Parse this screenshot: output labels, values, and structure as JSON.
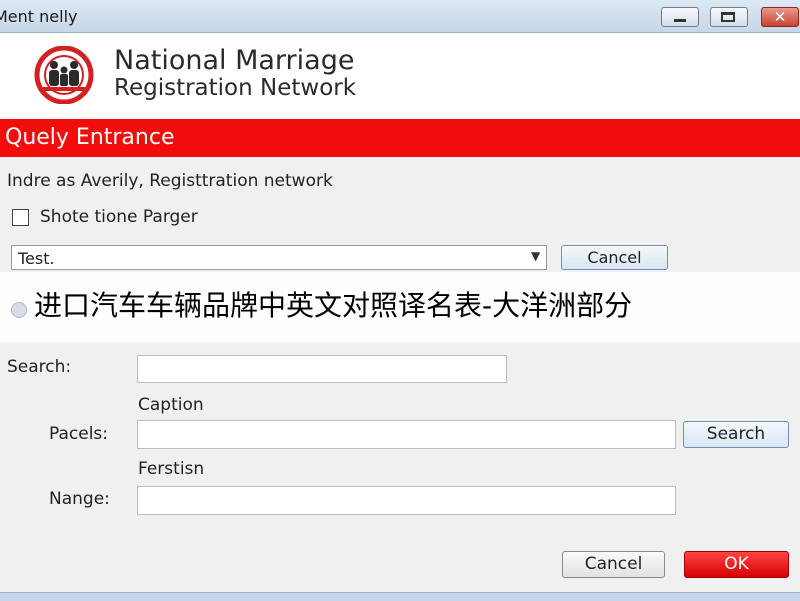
{
  "window": {
    "title": "Ment nelly",
    "controls": {
      "minimize_icon": "minimize-icon",
      "maximize_icon": "maximize-icon",
      "close_icon": "close-icon",
      "close_glyph": "✕"
    }
  },
  "header": {
    "org_line1": "National Marriage",
    "org_line2": "Registration Network",
    "logo_icon": "family-emblem-icon",
    "colors": {
      "accent": "#f20d0d",
      "logo_red": "#d42020"
    }
  },
  "banner": {
    "title": "Quely Entrance"
  },
  "form": {
    "description": "Indre as Averily, Registtration network",
    "checkbox_label": "Shote tione Parger",
    "checkbox_checked": false,
    "combo_value": "Test.",
    "cancel_top_label": "Cancel"
  },
  "overlay_caption": "进口汽车车辆品牌中英文对照译名表-大洋洲部分",
  "search": {
    "search_label": "Search:",
    "search_value": "",
    "caption_heading": "Caption",
    "pacels_label": "Pacels:",
    "pacels_value": "",
    "search_button": "Search",
    "ferstisn_heading": "Ferstisn",
    "nange_label": "Nange:",
    "nange_value": ""
  },
  "footer": {
    "cancel_label": "Cancel",
    "ok_label": "OK"
  }
}
